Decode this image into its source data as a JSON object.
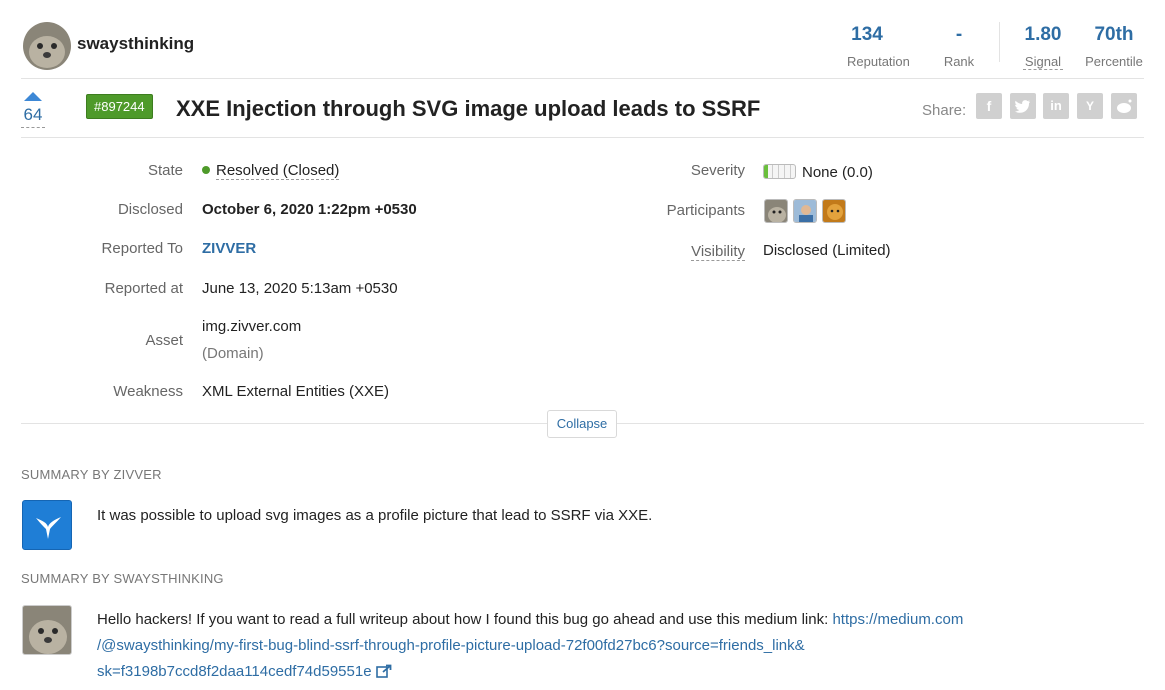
{
  "user": {
    "username": "swaysthinking"
  },
  "stats": [
    {
      "value": "134",
      "label": "Reputation"
    },
    {
      "value": "-",
      "label": "Rank"
    },
    {
      "value": "1.80",
      "label": "Signal"
    },
    {
      "value": "70th",
      "label": "Percentile"
    }
  ],
  "report": {
    "votes": "64",
    "id": "#897244",
    "title": "XXE Injection through SVG image upload leads to SSRF",
    "share_label": "Share:",
    "share_icons": [
      "facebook-icon",
      "twitter-icon",
      "linkedin-icon",
      "ycombinator-icon",
      "reddit-icon"
    ]
  },
  "details": {
    "state": {
      "label": "State",
      "value": "Resolved (Closed)"
    },
    "disclosed": {
      "label": "Disclosed",
      "value": "October 6, 2020 1:22pm +0530"
    },
    "reported_to": {
      "label": "Reported To",
      "value": "ZIVVER"
    },
    "reported_at": {
      "label": "Reported at",
      "value": "June 13, 2020 5:13am +0530"
    },
    "asset": {
      "label": "Asset",
      "value": "img.zivver.com",
      "type": "(Domain)"
    },
    "weakness": {
      "label": "Weakness",
      "value": "XML External Entities (XXE)"
    },
    "severity": {
      "label": "Severity",
      "value": "None (0.0)"
    },
    "participants": {
      "label": "Participants"
    },
    "visibility": {
      "label": "Visibility",
      "value": "Disclosed (Limited)"
    }
  },
  "collapse_label": "Collapse",
  "summaries": [
    {
      "heading": "SUMMARY BY ZIVVER",
      "text": "It was possible to upload svg images as a profile picture that lead to SSRF via XXE."
    },
    {
      "heading": "SUMMARY BY SWAYSTHINKING",
      "text": "Hello hackers! If you want to read a full writeup about how I found this bug go ahead and use this medium link: ",
      "link_line1": "https://medium.com",
      "link_line2": "/@swaysthinking/my-first-bug-blind-ssrf-through-profile-picture-upload-72f00fd27bc6?source=friends_link&",
      "link_line3": "sk=f3198b7ccd8f2daa114cedf74d59551e"
    }
  ],
  "colors": {
    "accent": "#2e6da4",
    "id_badge": "#4e9a2a",
    "resolved": "#4e9a2a"
  }
}
